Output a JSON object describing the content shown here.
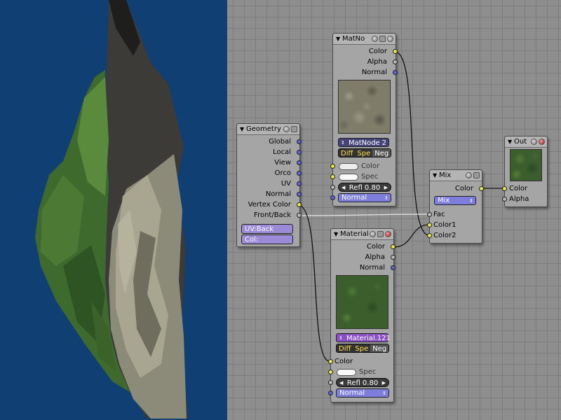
{
  "viewport": {
    "background": "#0f3f73"
  },
  "node_editor": {
    "background": "#8e8e8e"
  },
  "nodes": {
    "matnode": {
      "title": "MatNo",
      "outputs": {
        "color": "Color",
        "alpha": "Alpha",
        "normal": "Normal"
      },
      "material": {
        "name": "MatNode",
        "users": "2"
      },
      "flags": {
        "diff": "Diff",
        "spec": "Spe",
        "neg": "Neg"
      },
      "inputs": {
        "color": "Color",
        "spec": "Spec"
      },
      "refl": "Refl 0.80",
      "normal_select": "Normal"
    },
    "geometry": {
      "title": "Geometry",
      "outputs": {
        "global": "Global",
        "local": "Local",
        "view": "View",
        "orco": "Orco",
        "uv": "UV",
        "normal": "Normal",
        "vertex_color": "Vertex Color",
        "front_back": "Front/Back"
      },
      "uv_field": "UV:Back",
      "col_field": "Col:"
    },
    "material": {
      "title": "Material",
      "outputs": {
        "color": "Color",
        "alpha": "Alpha",
        "normal": "Normal"
      },
      "material": {
        "name": "Material.121"
      },
      "flags": {
        "diff": "Diff",
        "spec": "Spe",
        "neg": "Neg"
      },
      "inputs": {
        "color": "Color",
        "spec": "Spec"
      },
      "refl": "Refl 0.80",
      "normal_select": "Normal"
    },
    "mix": {
      "title": "Mix",
      "output": "Color",
      "blend": "Mix",
      "inputs": {
        "fac": "Fac",
        "color1": "Color1",
        "color2": "Color2"
      }
    },
    "out": {
      "title": "Out",
      "inputs": {
        "color": "Color",
        "alpha": "Alpha"
      }
    }
  },
  "icons": {
    "collapse": "collapse-triangle-icon",
    "preview_toggle": "preview-toggle-icon",
    "hide": "hide-sockets-icon",
    "material_sphere": "material-sphere-icon",
    "render_output": "render-output-icon"
  },
  "colors": {
    "socket_color": "#e8e84a",
    "socket_value": "#b8b8b8",
    "socket_vector": "#6262d8",
    "selector_matnode": "#44447a",
    "selector_material": "#8b4fc4",
    "dropdown": "#7d7ddc"
  }
}
